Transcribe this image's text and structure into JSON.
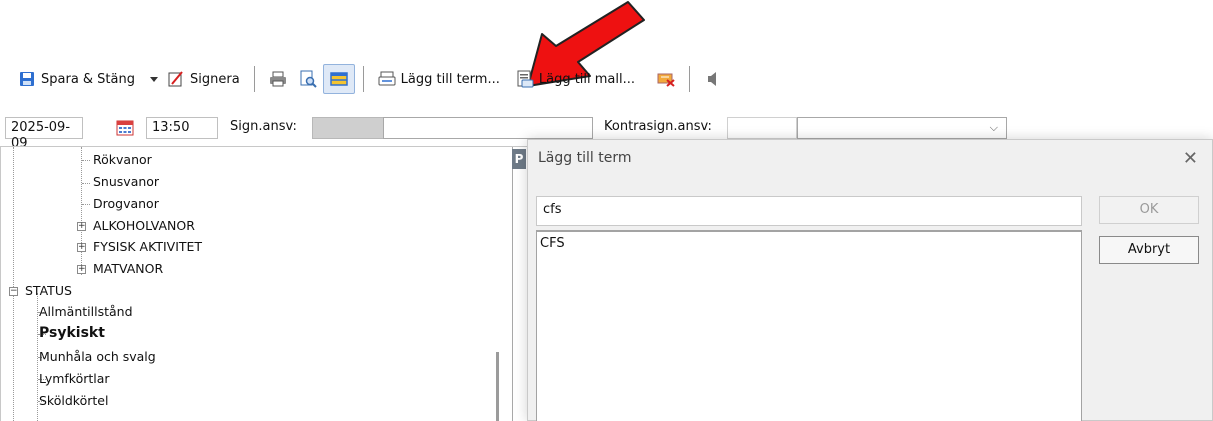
{
  "toolbar": {
    "save_close_label": "Spara & Stäng",
    "sign_label": "Signera",
    "add_term_label": "Lägg till term...",
    "add_template_label": "Lägg till mall..."
  },
  "signrow": {
    "date": "2025-09-09",
    "time": "13:50",
    "sign_resp_label": "Sign.ansv:",
    "cosign_resp_label": "Kontrasign.ansv:"
  },
  "tree": {
    "items": [
      "Rökvanor",
      "Snusvanor",
      "Drogvanor",
      "ALKOHOLVANOR",
      "FYSISK AKTIVITET",
      "MATVANOR",
      "STATUS",
      "Allmäntillstånd",
      "Psykiskt",
      "Munhåla och svalg",
      "Lymfkörtlar",
      "Sköldkörtel"
    ],
    "selected": "Psykiskt"
  },
  "mid_tab_letter": "P",
  "dialog": {
    "title": "Lägg till term",
    "search_value": "cfs",
    "results": [
      "CFS"
    ],
    "ok_label": "OK",
    "cancel_label": "Avbryt"
  },
  "colors": {
    "arrow": "#ee1111",
    "save_icon": "#2f6fd0",
    "highlight_border": "#93b3dd"
  }
}
